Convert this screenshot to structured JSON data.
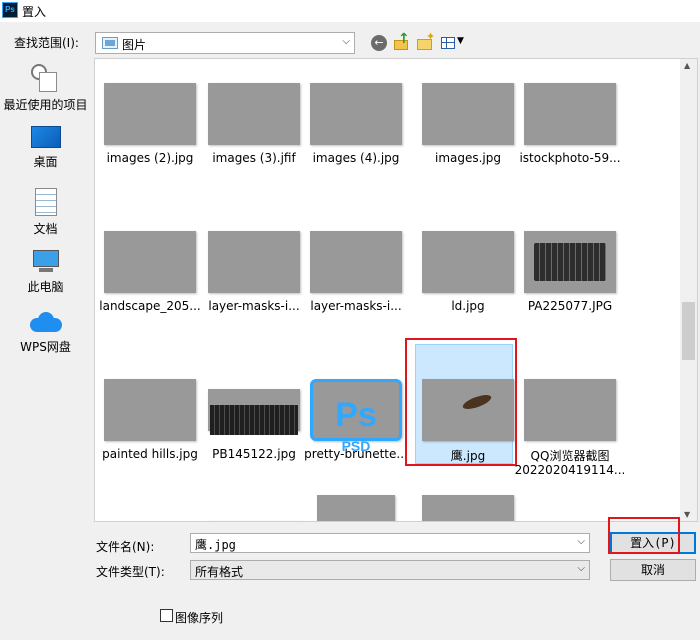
{
  "window": {
    "title": "置入",
    "app_icon": "Ps"
  },
  "toolbar": {
    "look_in_label": "查找范围(I):",
    "look_in_value": "图片"
  },
  "places": [
    {
      "label": "最近使用的项目",
      "icon": "recent-icon"
    },
    {
      "label": "桌面",
      "icon": "desktop-icon"
    },
    {
      "label": "文档",
      "icon": "documents-icon"
    },
    {
      "label": "此电脑",
      "icon": "computer-icon"
    },
    {
      "label": "WPS网盘",
      "icon": "cloud-icon"
    }
  ],
  "files": [
    {
      "name": "images (2).jpg"
    },
    {
      "name": "images (3).jfif"
    },
    {
      "name": "images (4).jpg"
    },
    {
      "name": "images.jpg"
    },
    {
      "name": "istockphoto-59..."
    },
    {
      "name": "landscape_205..."
    },
    {
      "name": "layer-masks-i..."
    },
    {
      "name": "layer-masks-i..."
    },
    {
      "name": "ld.jpg"
    },
    {
      "name": "PA225077.JPG"
    },
    {
      "name": "painted hills.jpg"
    },
    {
      "name": "PB145122.jpg"
    },
    {
      "name": "pretty-brunette..."
    },
    {
      "name": "鹰.jpg",
      "selected": true
    },
    {
      "name": "QQ浏览器截图",
      "name_line2": "2022020419114..."
    }
  ],
  "psd_icon": {
    "top": "Ps",
    "bottom": "PSD"
  },
  "filename": {
    "label": "文件名(N):",
    "value": "鹰.jpg"
  },
  "filetype": {
    "label": "文件类型(T):",
    "value": "所有格式"
  },
  "buttons": {
    "place": "置入(P)",
    "cancel": "取消"
  },
  "image_sequence": {
    "label": "图像序列",
    "checked": false
  },
  "colors": {
    "highlight": "#e0161c",
    "selection": "#cce8ff",
    "accent": "#0078d7"
  }
}
